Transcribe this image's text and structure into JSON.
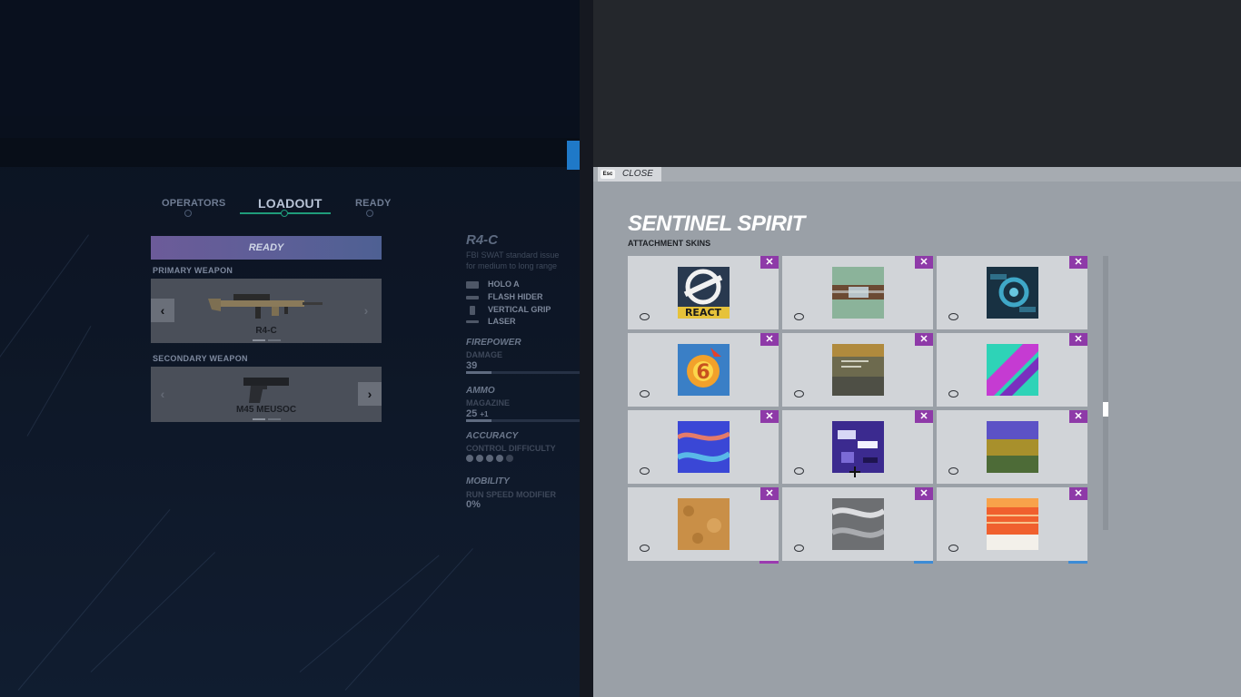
{
  "nav": {
    "tabs": [
      "OPERATORS",
      "LOADOUT",
      "READY"
    ],
    "active": "LOADOUT"
  },
  "ready_bar": "READY",
  "primary": {
    "label": "PRIMARY WEAPON",
    "name": "R4-C"
  },
  "secondary": {
    "label": "SECONDARY WEAPON",
    "name": "M45 MEUSOC"
  },
  "weapon": {
    "title": "R4-C",
    "desc_lines": [
      "FBI SWAT standard issue",
      "for medium to long range"
    ],
    "attachments": [
      "HOLO A",
      "FLASH HIDER",
      "VERTICAL GRIP",
      "LASER"
    ],
    "firepower": {
      "title": "FIREPOWER",
      "sub": "DAMAGE",
      "value": "39",
      "fraction": 0.22
    },
    "ammo": {
      "title": "AMMO",
      "sub": "MAGAZINE",
      "value": "25",
      "extra": "+1",
      "fraction": 0.22
    },
    "accuracy": {
      "title": "ACCURACY",
      "sub": "CONTROL DIFFICULTY",
      "dots_filled": 4,
      "dots_total": 5
    },
    "mobility": {
      "title": "MOBILITY",
      "sub": "RUN SPEED MODIFIER",
      "value": "0%"
    }
  },
  "overlay": {
    "esc_key": "Esc",
    "close_label": "CLOSE",
    "title": "SENTINEL SPIRIT",
    "subtitle": "ATTACHMENT SKINS",
    "remove_glyph": "✕",
    "skins": [
      {
        "thumb": "react-logo",
        "label": "REACT"
      },
      {
        "thumb": "green-metal-tube"
      },
      {
        "thumb": "blue-ring-tech"
      },
      {
        "thumb": "six-siege-flame"
      },
      {
        "thumb": "olive-camo-print"
      },
      {
        "thumb": "teal-pink-stripes"
      },
      {
        "thumb": "blue-marble-swirl"
      },
      {
        "thumb": "purple-glitch"
      },
      {
        "thumb": "iridescent-scales"
      },
      {
        "thumb": "tan-leather"
      },
      {
        "thumb": "silver-wave"
      },
      {
        "thumb": "orange-sunset-lines"
      }
    ],
    "peek_colors": [
      "#9b3ab0",
      "#3c8bd6",
      "#3c8bd6"
    ]
  }
}
